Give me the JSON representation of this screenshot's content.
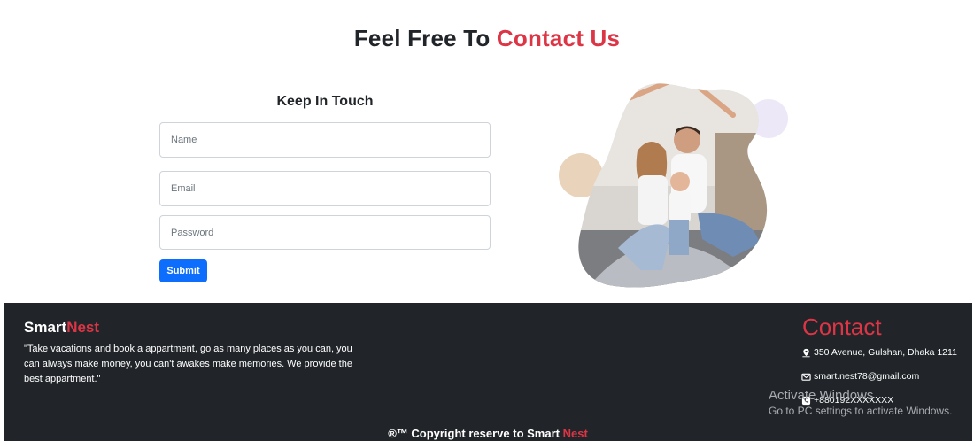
{
  "header": {
    "title_main": "Feel Free To",
    "title_accent": "Contact Us"
  },
  "form": {
    "title": "Keep In Touch",
    "name_placeholder": "Name",
    "email_placeholder": "Email",
    "password_placeholder": "Password",
    "submit_label": "Submit"
  },
  "footer": {
    "brand_main": "Smart",
    "brand_accent": "Nest",
    "tagline": "\"Take vacations and book a appartment, go as many places as you can, you can always make money, you can't awakes make memories. We provide the best appartment.\"",
    "contact_heading": "Contact",
    "address": "350 Avenue, Gulshan, Dhaka 1211",
    "email": "smart.nest78@gmail.com",
    "phone": "+880192XXXXXXX",
    "copyright_main": "®™ Copyright reserve to Smart",
    "copyright_accent": "Nest"
  },
  "os_overlay": {
    "line1": "Activate Windows",
    "line2": "Go to PC settings to activate Windows."
  },
  "icons": {
    "address": "map-pin-icon",
    "email": "envelope-icon",
    "phone": "phone-icon"
  },
  "colors": {
    "accent": "#dc3545",
    "primary": "#0d6efd",
    "footer_bg": "#212529"
  }
}
